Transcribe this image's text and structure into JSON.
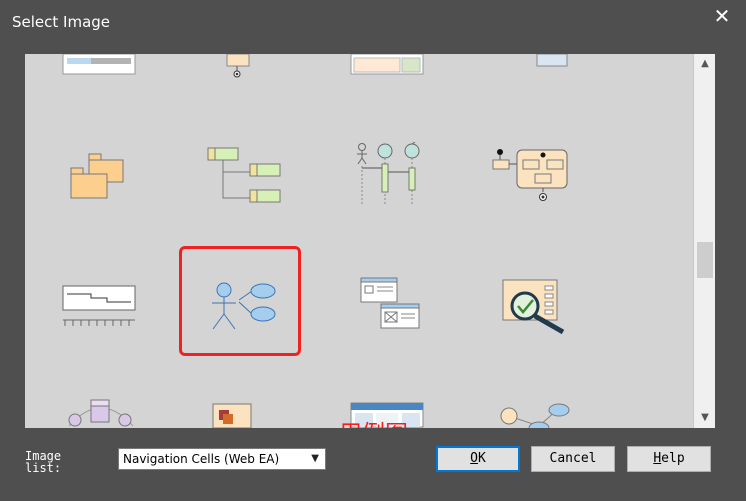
{
  "dialog": {
    "title": "Select Image",
    "close_glyph": "✕"
  },
  "annotation": {
    "text": "用例图",
    "color": "#ff1a1a"
  },
  "image_list": {
    "label": "Image list:",
    "selected": "Navigation Cells (Web EA)"
  },
  "buttons": {
    "ok_first": "O",
    "ok_rest": "K",
    "cancel": "Cancel",
    "help_first": "H",
    "help_rest": "elp"
  },
  "icons": [
    "table-diagram-icon",
    "state-partial-icon",
    "requirements-diagram-icon",
    "component-partial-icon",
    "package-diagram-icon",
    "class-hierarchy-icon",
    "sequence-diagram-icon",
    "activity-state-icon",
    "timing-diagram-icon",
    "use-case-diagram-icon",
    "user-interface-icon",
    "inspection-diagram-icon",
    "composite-structure-icon",
    "deployment-icon",
    "web-page-icon",
    "mind-map-icon"
  ]
}
